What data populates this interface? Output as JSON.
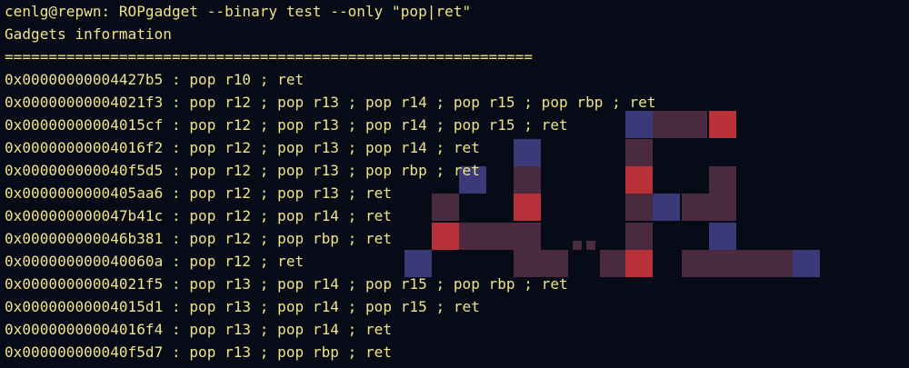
{
  "terminal": {
    "command_line": "cenlg@repwn: ROPgadget --binary test --only \"pop|ret\"",
    "header": "Gadgets information",
    "separator": "============================================================",
    "gadgets": [
      "0x00000000004427b5 : pop r10 ; ret",
      "0x00000000004021f3 : pop r12 ; pop r13 ; pop r14 ; pop r15 ; pop rbp ; ret",
      "0x00000000004015cf : pop r12 ; pop r13 ; pop r14 ; pop r15 ; ret",
      "0x00000000004016f2 : pop r12 ; pop r13 ; pop r14 ; ret",
      "0x000000000040f5d5 : pop r12 ; pop r13 ; pop rbp ; ret",
      "0x0000000000405aa6 : pop r12 ; pop r13 ; ret",
      "0x000000000047b41c : pop r12 ; pop r14 ; ret",
      "0x000000000046b381 : pop r12 ; pop rbp ; ret",
      "0x000000000040060a : pop r12 ; ret",
      "0x00000000004021f5 : pop r13 ; pop r14 ; pop r15 ; pop rbp ; ret",
      "0x00000000004015d1 : pop r13 ; pop r14 ; pop r15 ; ret",
      "0x00000000004016f4 : pop r13 ; pop r14 ; ret",
      "0x000000000040f5d7 : pop r13 ; pop rbp ; ret"
    ]
  },
  "colors": {
    "background": "#070b17",
    "text": "#f2e486",
    "logo_maroon": "#4a2a3e",
    "logo_red": "#b83038",
    "logo_blue": "#3a3a78"
  },
  "icons": {
    "watermark": "pixel-logo-watermark"
  }
}
